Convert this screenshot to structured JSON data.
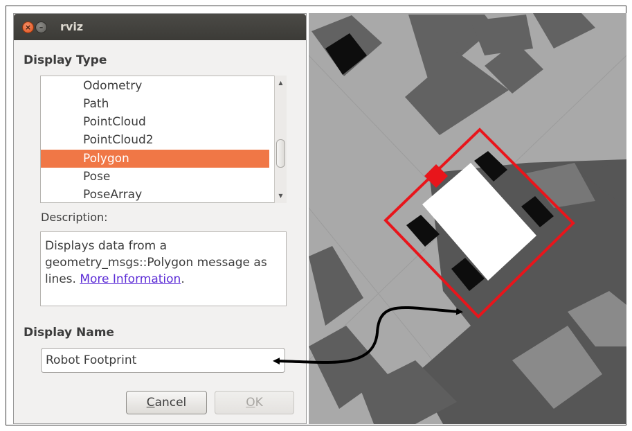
{
  "window": {
    "title": "rviz",
    "close_icon": "×",
    "minimize_icon": "–"
  },
  "display_type": {
    "label": "Display Type",
    "items": [
      {
        "label": "Odometry",
        "selected": false
      },
      {
        "label": "Path",
        "selected": false
      },
      {
        "label": "PointCloud",
        "selected": false
      },
      {
        "label": "PointCloud2",
        "selected": false
      },
      {
        "label": "Polygon",
        "selected": true
      },
      {
        "label": "Pose",
        "selected": false
      },
      {
        "label": "PoseArray",
        "selected": false
      }
    ],
    "scroll_up_icon": "▲",
    "scroll_down_icon": "▼"
  },
  "description": {
    "label": "Description:",
    "text": "Displays data from a geometry_msgs::Polygon message as lines.",
    "link_text": "More Information",
    "trailing": "."
  },
  "display_name": {
    "label": "Display Name",
    "value": "Robot Footprint"
  },
  "buttons": {
    "cancel": "Cancel",
    "ok": "OK"
  },
  "colors": {
    "selection": "#f07746",
    "footprint": "#e8151b",
    "link": "#5b2bd6",
    "map_free": "#a9a9a9",
    "map_cost": "#555555",
    "map_dark": "#626262"
  }
}
